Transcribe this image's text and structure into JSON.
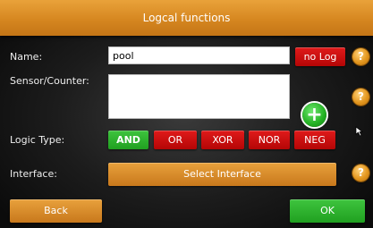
{
  "title": "Logcal functions",
  "name": {
    "label": "Name:",
    "value": "pool",
    "no_log_label": "no Log"
  },
  "sensor": {
    "label": "Sensor/Counter:",
    "value": "",
    "add_icon": "plus-circle-icon"
  },
  "logic": {
    "label": "Logic Type:",
    "options": [
      "AND",
      "OR",
      "XOR",
      "NOR",
      "NEG"
    ],
    "selected": "AND"
  },
  "interface": {
    "label": "Interface:",
    "button_label": "Select Interface"
  },
  "footer": {
    "back_label": "Back",
    "ok_label": "OK"
  },
  "help_icon_glyph": "?",
  "colors": {
    "title_bar": "#d68720",
    "active": "#2fae2f",
    "inactive": "#c80f0f",
    "orange": "#d68720"
  }
}
